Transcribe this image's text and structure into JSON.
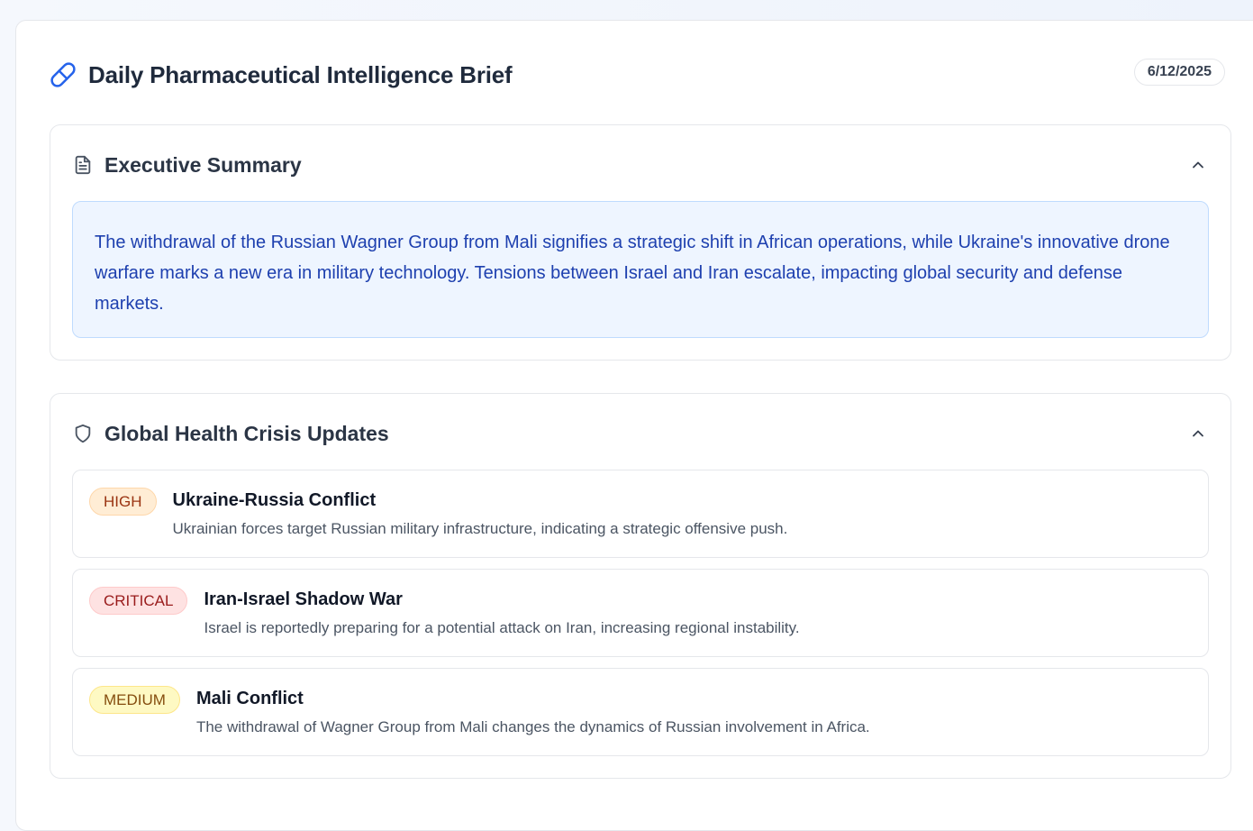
{
  "brief": {
    "title": "Daily Pharmaceutical Intelligence Brief",
    "date": "6/12/2025",
    "icon": "pill-icon"
  },
  "summary": {
    "title": "Executive Summary",
    "icon": "document-icon",
    "text": "The withdrawal of the Russian Wagner Group from Mali signifies a strategic shift in African operations, while Ukraine's innovative drone warfare marks a new era in military technology. Tensions between Israel and Iran escalate, impacting global security and defense markets."
  },
  "health": {
    "title": "Global Health Crisis Updates",
    "icon": "shield-icon",
    "items": [
      {
        "severity": "HIGH",
        "title": "Ukraine-Russia Conflict",
        "description": "Ukrainian forces target Russian military infrastructure, indicating a strategic offensive push."
      },
      {
        "severity": "CRITICAL",
        "title": "Iran-Israel Shadow War",
        "description": "Israel is reportedly preparing for a potential attack on Iran, increasing regional instability."
      },
      {
        "severity": "MEDIUM",
        "title": "Mali Conflict",
        "description": "The withdrawal of Wagner Group from Mali changes the dynamics of Russian involvement in Africa."
      }
    ]
  },
  "colors": {
    "accent": "#2563eb",
    "summary_bg": "#eef5ff",
    "summary_text": "#1e40af",
    "high": "#9a3412",
    "critical": "#991b1b",
    "medium": "#854d0e"
  }
}
